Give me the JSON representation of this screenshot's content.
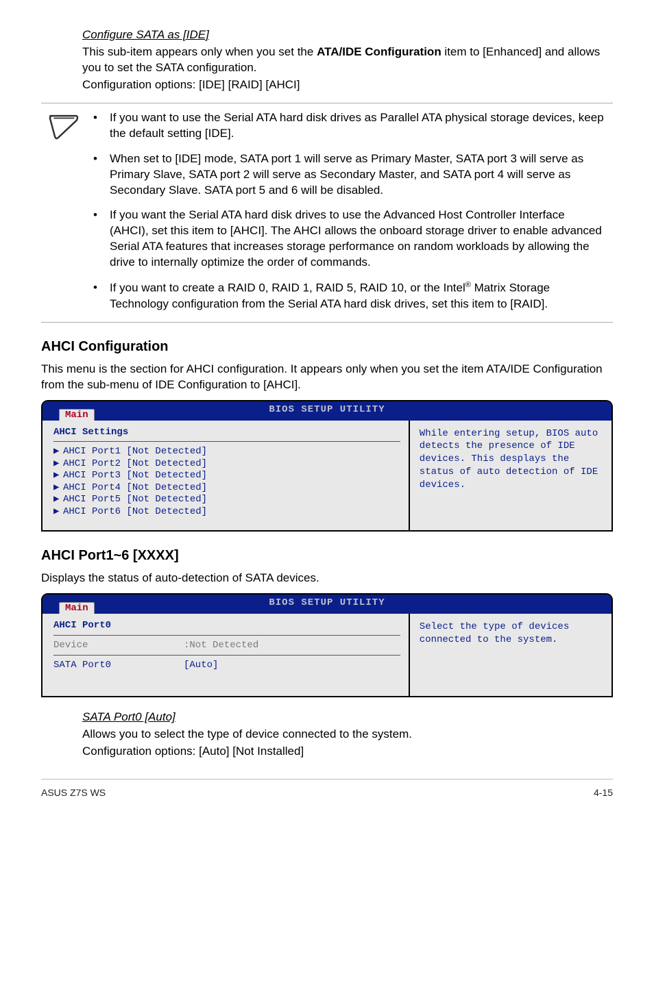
{
  "intro": {
    "subtitle": "Configure SATA as [IDE]",
    "line1_pre": "This sub-item appears only when you set the ",
    "line1_bold": "ATA/IDE Configuration",
    "line1_post": " item to [Enhanced] and allows you to set the SATA configuration.",
    "line2": "Configuration options: [IDE] [RAID] [AHCI]"
  },
  "notes": {
    "n1": "If you want to use the Serial ATA hard disk drives as Parallel ATA physical storage devices, keep the default setting [IDE].",
    "n2": "When set to [IDE] mode, SATA port 1 will serve as Primary Master, SATA port 3 will serve as Primary Slave, SATA port 2 will serve as Secondary Master, and SATA port 4 will serve as Secondary Slave. SATA port 5 and 6 will be disabled.",
    "n3": "If you want the Serial ATA hard disk drives to use the Advanced Host Controller Interface (AHCI), set this item to [AHCI]. The AHCI allows the onboard storage driver to enable advanced Serial ATA features that increases storage performance on random workloads by allowing the drive to internally optimize the order of commands.",
    "n4_pre": "If you want to create a RAID 0, RAID 1, RAID 5, RAID 10, or the Intel",
    "n4_sup": "®",
    "n4_post": " Matrix Storage Technology configuration from the Serial ATA hard disk drives, set this item to [RAID]."
  },
  "ahci_cfg": {
    "heading": "AHCI Configuration",
    "desc": "This menu is the section for AHCI configuration. It appears only when you set the item ATA/IDE Configuration from the sub-menu of IDE Configuration to [AHCI]."
  },
  "bios_common": {
    "title": "BIOS SETUP UTILITY",
    "tab": "Main"
  },
  "bios1": {
    "heading": "AHCI Settings",
    "rows": {
      "r1": "AHCI Port1 [Not Detected]",
      "r2": "AHCI Port2 [Not Detected]",
      "r3": "AHCI Port3 [Not Detected]",
      "r4": "AHCI Port4 [Not Detected]",
      "r5": "AHCI Port5 [Not Detected]",
      "r6": "AHCI Port6 [Not Detected]"
    },
    "help": "While entering setup, BIOS auto detects the presence of IDE devices. This desplays the status of auto detection of IDE devices."
  },
  "ahci_port": {
    "heading": "AHCI Port1~6 [XXXX]",
    "desc": "Displays the status of auto-detection of SATA devices."
  },
  "bios2": {
    "heading": "AHCI Port0",
    "device_label": "Device",
    "device_value": ":Not Detected",
    "sata_label": "SATA Port0",
    "sata_value": "[Auto]",
    "help": "Select the type of devices connected to the system."
  },
  "sata_port": {
    "subtitle": "SATA Port0 [Auto]",
    "line1": "Allows you to select the type of device connected to the system.",
    "line2": "Configuration options: [Auto] [Not Installed]"
  },
  "footer": {
    "left": "ASUS Z7S WS",
    "right": "4-15"
  }
}
